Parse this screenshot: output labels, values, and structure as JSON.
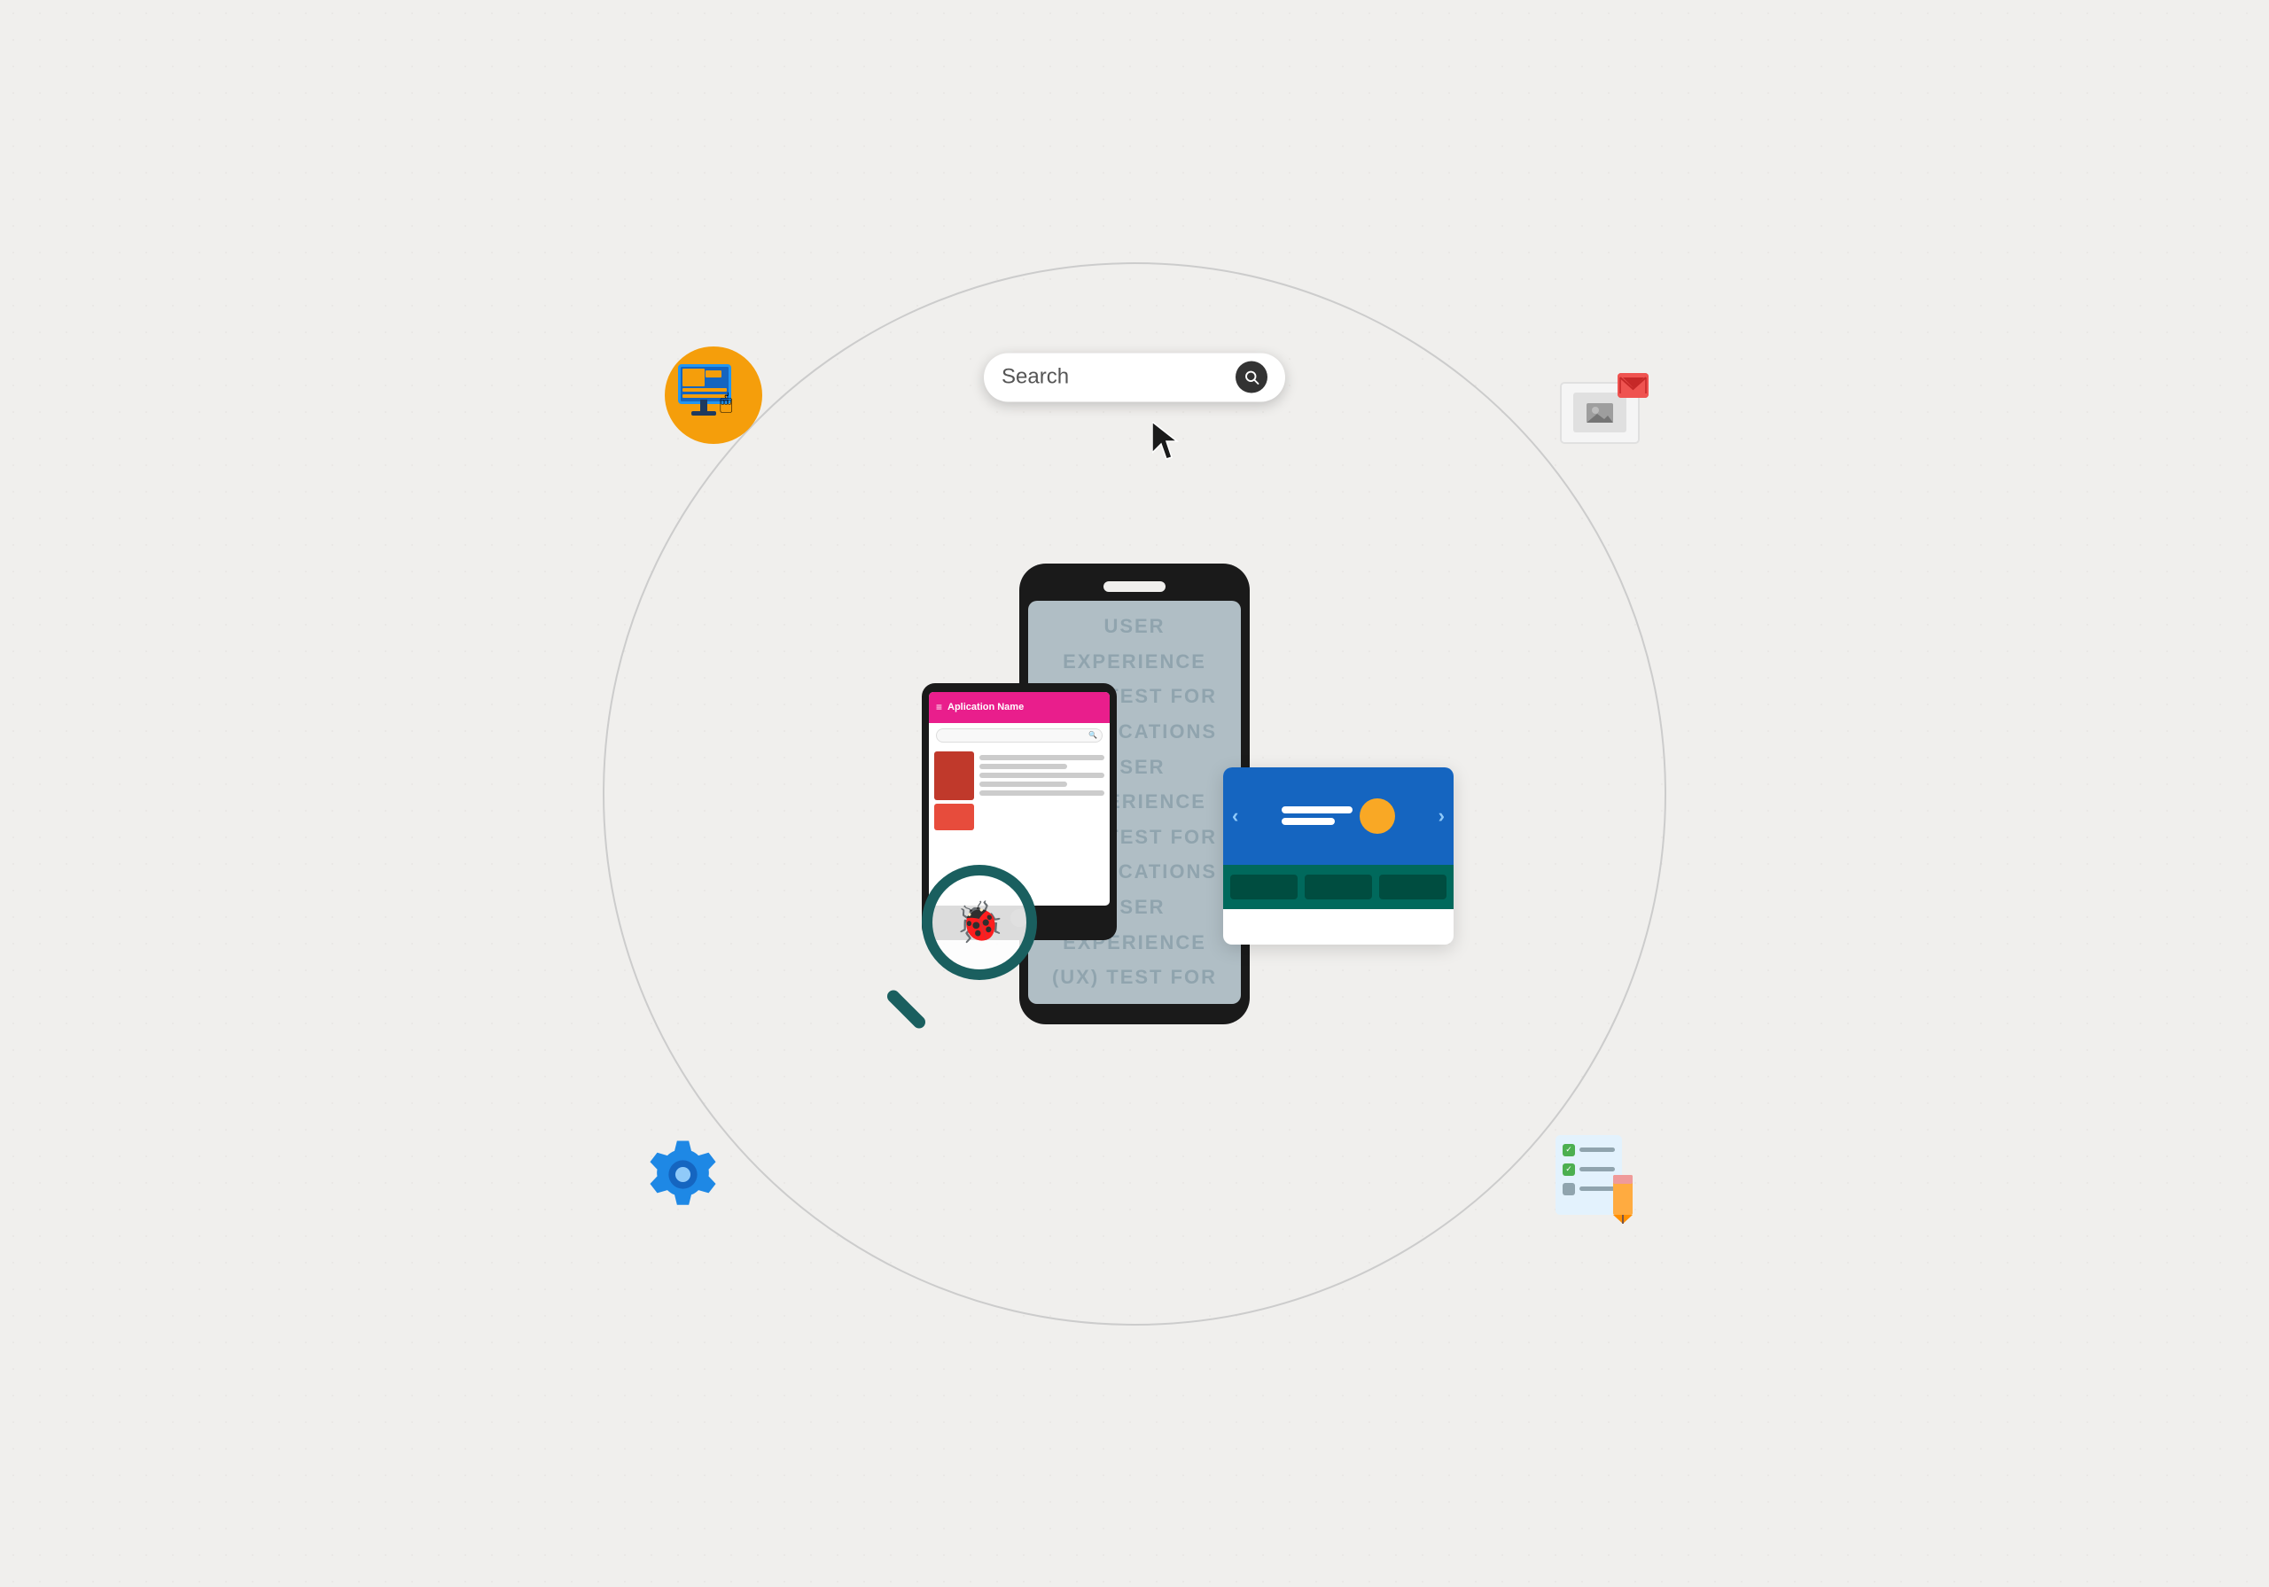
{
  "background": {
    "color": "#f0efed"
  },
  "search_bar": {
    "placeholder": "Search",
    "text": "Search",
    "icon": "search-icon"
  },
  "phone": {
    "screen_text": [
      "USER EXPERIENCE",
      "(UX) TEST FOR",
      "APPLICATIONS",
      "USER EXPERIENCE",
      "(UX) TEST FOR",
      "APPLICATIONS",
      "USER EXPERIENCE",
      "(UX) TEST FOR"
    ]
  },
  "tablet": {
    "title": "Aplication Name",
    "menu_icon": "≡"
  },
  "corner_icons": {
    "top_left": "monitor-computer-icon",
    "top_right": "image-mail-icon",
    "bottom_left": "gear-settings-icon",
    "bottom_right": "checklist-pencil-icon"
  }
}
